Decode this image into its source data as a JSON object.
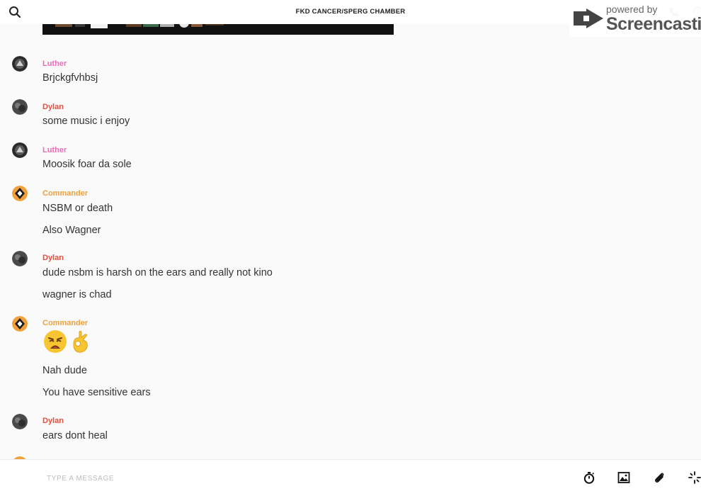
{
  "header": {
    "title": "FKD CANCER/SPERG CHAMBER",
    "icons": [
      "search-icon",
      "phone-icon",
      "info-icon"
    ]
  },
  "watermark": {
    "line1": "powered by",
    "line2": "Screencastify"
  },
  "messages": [
    {
      "author": "Luther",
      "author_color": "#ea6fb5",
      "lines": [
        "Brjckgfvhbsj"
      ]
    },
    {
      "author": "Dylan",
      "author_color": "#e0503f",
      "lines": [
        "some music i enjoy"
      ]
    },
    {
      "author": "Luther",
      "author_color": "#ea6fb5",
      "lines": [
        "Moosik foar da sole"
      ]
    },
    {
      "author": "Commander",
      "author_color": "#f0a03a",
      "lines": [
        "NSBM or death",
        "Also Wagner"
      ]
    },
    {
      "author": "Dylan",
      "author_color": "#e0503f",
      "lines": [
        "dude nsbm is harsh on the ears and really not kino",
        "wagner is chad"
      ]
    },
    {
      "author": "Commander",
      "author_color": "#f0a03a",
      "emojis": [
        "weary-face-emoji",
        "ok-hand-emoji"
      ],
      "lines": [
        "Nah dude",
        "You have sensitive ears"
      ]
    },
    {
      "author": "Dylan",
      "author_color": "#e0503f",
      "lines": [
        "ears dont heal"
      ]
    }
  ],
  "composer": {
    "placeholder": "TYPE A MESSAGE",
    "value": "",
    "buttons": [
      "timer-icon",
      "image-icon",
      "paperclip-icon",
      "sparkle-icon"
    ]
  }
}
